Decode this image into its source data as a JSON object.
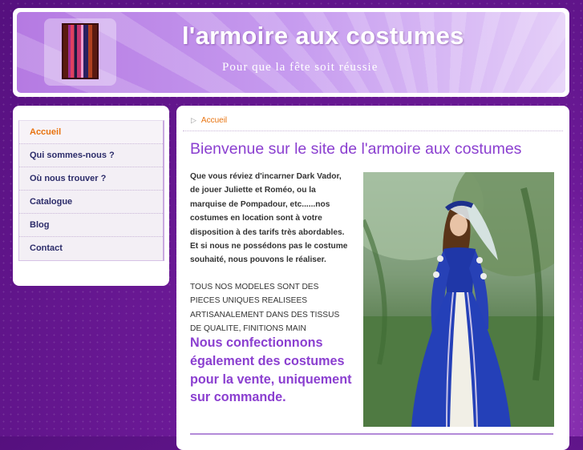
{
  "header": {
    "site_title": "l'armoire aux costumes",
    "tagline": "Pour que la fête soit réussie"
  },
  "sidebar": {
    "items": [
      {
        "label": "Accueil",
        "active": true
      },
      {
        "label": "Qui sommes-nous ?",
        "active": false
      },
      {
        "label": "Où nous trouver ?",
        "active": false
      },
      {
        "label": "Catalogue",
        "active": false
      },
      {
        "label": "Blog",
        "active": false
      },
      {
        "label": "Contact",
        "active": false
      }
    ]
  },
  "main": {
    "breadcrumb": "Accueil",
    "heading": "Bienvenue sur le site de l'armoire aux costumes",
    "intro_lines": [
      "Que vous réviez d'incarner Dark Vador,",
      "de jouer Juliette et Roméo, ou la",
      "marquise de Pompadour, etc......nos",
      "costumes en location sont à votre",
      "disposition à des tarifs très abordables.",
      "Et si nous ne possédons pas le costume",
      "souhaité, nous pouvons le réaliser."
    ],
    "models_lines": [
      "TOUS NOS MODELES SONT DES",
      "PIECES UNIQUES REALISEES",
      "ARTISANALEMENT  DANS DES TISSUS",
      "DE QUALITE, FINITIONS MAIN"
    ],
    "callout_lines": [
      "Nous confectionnons",
      "également des costumes",
      "pour la vente, uniquement",
      "sur commande."
    ]
  },
  "colors": {
    "accent": "#8b3fd0",
    "active_nav": "#e8730f",
    "nav_text": "#2c2c6a"
  },
  "icons": {
    "breadcrumb": "chevron-right-icon"
  }
}
